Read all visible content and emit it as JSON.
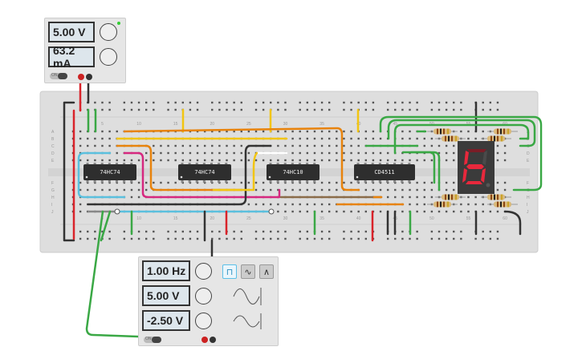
{
  "power_supply": {
    "voltage": "5.00 V",
    "current": "63.2 mA",
    "switch_label": "ON"
  },
  "function_generator": {
    "frequency": "1.00 Hz",
    "amplitude": "5.00 V",
    "offset": "-2.50 V",
    "switch_label": "ON",
    "waveforms": [
      {
        "name": "square",
        "icon": "square-wave-icon",
        "selected": true
      },
      {
        "name": "sine",
        "icon": "sine-wave-icon",
        "selected": false
      },
      {
        "name": "triangle",
        "icon": "triangle-wave-icon",
        "selected": false
      }
    ]
  },
  "breadboard": {
    "column_labels": [
      "5",
      "10",
      "15",
      "20",
      "25",
      "30",
      "35",
      "40",
      "45",
      "50",
      "55",
      "60"
    ],
    "row_labels_top": [
      "A",
      "B",
      "C",
      "D",
      "E"
    ],
    "row_labels_bottom": [
      "F",
      "G",
      "H",
      "I",
      "J"
    ]
  },
  "chips": [
    {
      "label": "74HC74"
    },
    {
      "label": "74HC74"
    },
    {
      "label": "74HC10"
    },
    {
      "label": "CD4511"
    }
  ],
  "seven_segment": {
    "digit_shown": "6",
    "lit_color": "#e8283c"
  },
  "colors": {
    "red_wire": "#d9232a",
    "black_wire": "#333333",
    "green_wire": "#3aa845",
    "orange_wire": "#e8830c",
    "yellow_wire": "#f2c511",
    "blue_wire": "#5bc0de",
    "magenta_wire": "#d6287f",
    "board": "#dedede"
  }
}
